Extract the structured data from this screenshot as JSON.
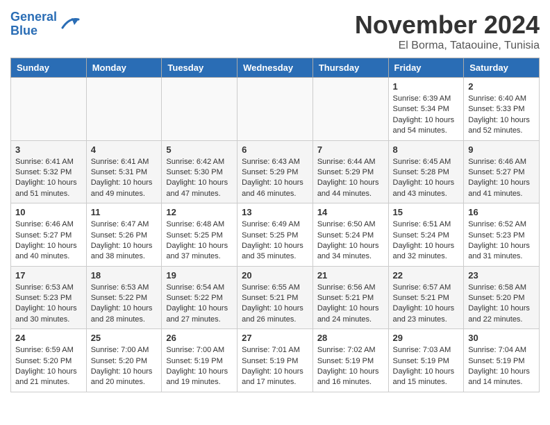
{
  "header": {
    "logo_line1": "General",
    "logo_line2": "Blue",
    "title": "November 2024",
    "location": "El Borma, Tataouine, Tunisia"
  },
  "weekdays": [
    "Sunday",
    "Monday",
    "Tuesday",
    "Wednesday",
    "Thursday",
    "Friday",
    "Saturday"
  ],
  "weeks": [
    [
      {
        "day": "",
        "info": ""
      },
      {
        "day": "",
        "info": ""
      },
      {
        "day": "",
        "info": ""
      },
      {
        "day": "",
        "info": ""
      },
      {
        "day": "",
        "info": ""
      },
      {
        "day": "1",
        "info": "Sunrise: 6:39 AM\nSunset: 5:34 PM\nDaylight: 10 hours and 54 minutes."
      },
      {
        "day": "2",
        "info": "Sunrise: 6:40 AM\nSunset: 5:33 PM\nDaylight: 10 hours and 52 minutes."
      }
    ],
    [
      {
        "day": "3",
        "info": "Sunrise: 6:41 AM\nSunset: 5:32 PM\nDaylight: 10 hours and 51 minutes."
      },
      {
        "day": "4",
        "info": "Sunrise: 6:41 AM\nSunset: 5:31 PM\nDaylight: 10 hours and 49 minutes."
      },
      {
        "day": "5",
        "info": "Sunrise: 6:42 AM\nSunset: 5:30 PM\nDaylight: 10 hours and 47 minutes."
      },
      {
        "day": "6",
        "info": "Sunrise: 6:43 AM\nSunset: 5:29 PM\nDaylight: 10 hours and 46 minutes."
      },
      {
        "day": "7",
        "info": "Sunrise: 6:44 AM\nSunset: 5:29 PM\nDaylight: 10 hours and 44 minutes."
      },
      {
        "day": "8",
        "info": "Sunrise: 6:45 AM\nSunset: 5:28 PM\nDaylight: 10 hours and 43 minutes."
      },
      {
        "day": "9",
        "info": "Sunrise: 6:46 AM\nSunset: 5:27 PM\nDaylight: 10 hours and 41 minutes."
      }
    ],
    [
      {
        "day": "10",
        "info": "Sunrise: 6:46 AM\nSunset: 5:27 PM\nDaylight: 10 hours and 40 minutes."
      },
      {
        "day": "11",
        "info": "Sunrise: 6:47 AM\nSunset: 5:26 PM\nDaylight: 10 hours and 38 minutes."
      },
      {
        "day": "12",
        "info": "Sunrise: 6:48 AM\nSunset: 5:25 PM\nDaylight: 10 hours and 37 minutes."
      },
      {
        "day": "13",
        "info": "Sunrise: 6:49 AM\nSunset: 5:25 PM\nDaylight: 10 hours and 35 minutes."
      },
      {
        "day": "14",
        "info": "Sunrise: 6:50 AM\nSunset: 5:24 PM\nDaylight: 10 hours and 34 minutes."
      },
      {
        "day": "15",
        "info": "Sunrise: 6:51 AM\nSunset: 5:24 PM\nDaylight: 10 hours and 32 minutes."
      },
      {
        "day": "16",
        "info": "Sunrise: 6:52 AM\nSunset: 5:23 PM\nDaylight: 10 hours and 31 minutes."
      }
    ],
    [
      {
        "day": "17",
        "info": "Sunrise: 6:53 AM\nSunset: 5:23 PM\nDaylight: 10 hours and 30 minutes."
      },
      {
        "day": "18",
        "info": "Sunrise: 6:53 AM\nSunset: 5:22 PM\nDaylight: 10 hours and 28 minutes."
      },
      {
        "day": "19",
        "info": "Sunrise: 6:54 AM\nSunset: 5:22 PM\nDaylight: 10 hours and 27 minutes."
      },
      {
        "day": "20",
        "info": "Sunrise: 6:55 AM\nSunset: 5:21 PM\nDaylight: 10 hours and 26 minutes."
      },
      {
        "day": "21",
        "info": "Sunrise: 6:56 AM\nSunset: 5:21 PM\nDaylight: 10 hours and 24 minutes."
      },
      {
        "day": "22",
        "info": "Sunrise: 6:57 AM\nSunset: 5:21 PM\nDaylight: 10 hours and 23 minutes."
      },
      {
        "day": "23",
        "info": "Sunrise: 6:58 AM\nSunset: 5:20 PM\nDaylight: 10 hours and 22 minutes."
      }
    ],
    [
      {
        "day": "24",
        "info": "Sunrise: 6:59 AM\nSunset: 5:20 PM\nDaylight: 10 hours and 21 minutes."
      },
      {
        "day": "25",
        "info": "Sunrise: 7:00 AM\nSunset: 5:20 PM\nDaylight: 10 hours and 20 minutes."
      },
      {
        "day": "26",
        "info": "Sunrise: 7:00 AM\nSunset: 5:19 PM\nDaylight: 10 hours and 19 minutes."
      },
      {
        "day": "27",
        "info": "Sunrise: 7:01 AM\nSunset: 5:19 PM\nDaylight: 10 hours and 17 minutes."
      },
      {
        "day": "28",
        "info": "Sunrise: 7:02 AM\nSunset: 5:19 PM\nDaylight: 10 hours and 16 minutes."
      },
      {
        "day": "29",
        "info": "Sunrise: 7:03 AM\nSunset: 5:19 PM\nDaylight: 10 hours and 15 minutes."
      },
      {
        "day": "30",
        "info": "Sunrise: 7:04 AM\nSunset: 5:19 PM\nDaylight: 10 hours and 14 minutes."
      }
    ]
  ]
}
